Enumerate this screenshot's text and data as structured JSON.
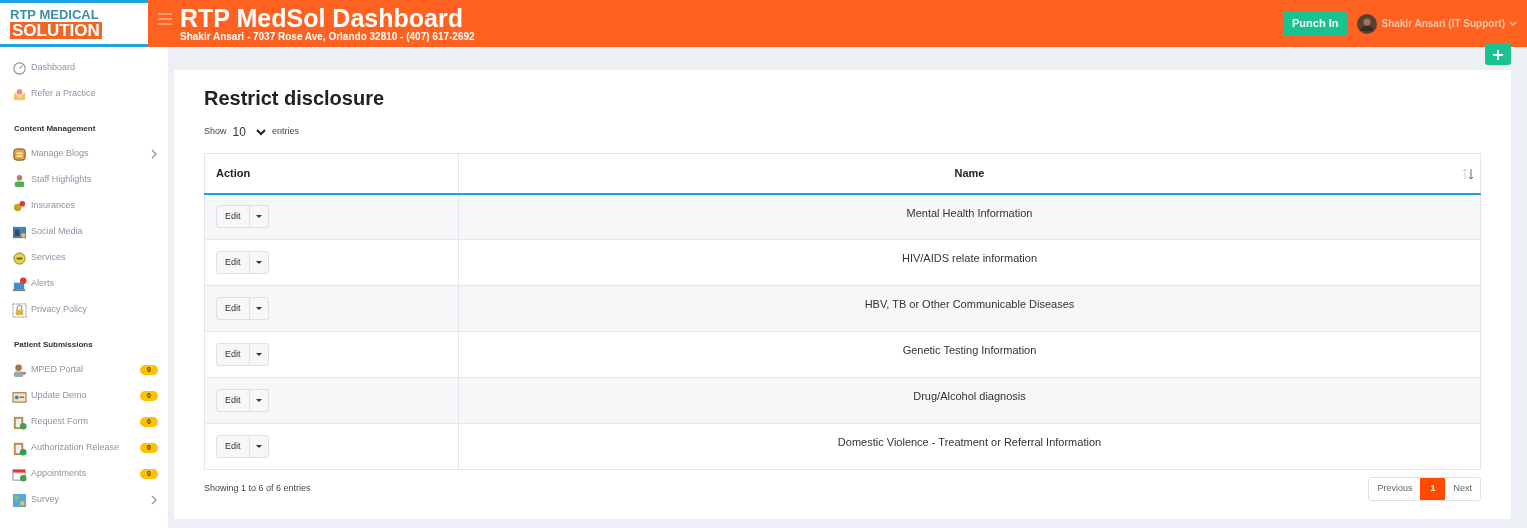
{
  "header": {
    "logo_top": "RTP MEDICAL",
    "logo_bottom": "SOLUTION",
    "title": "RTP MedSol Dashboard",
    "subtitle": "Shakir Ansari - 7037 Rose Ave, Orlando 32810 - (407) 617-2692",
    "punch_button": "Punch In",
    "user": "Shakir Ansari (IT Support)"
  },
  "sidebar": {
    "sections": [
      {
        "items": [
          {
            "label": "Dashboard",
            "has_submenu": false
          },
          {
            "label": "Refer a Practice",
            "has_submenu": false
          }
        ]
      },
      {
        "heading": "Content Management",
        "items": [
          {
            "label": "Manage Blogs",
            "has_submenu": true
          },
          {
            "label": "Staff Highlights",
            "has_submenu": false
          },
          {
            "label": "Insurances",
            "has_submenu": false
          },
          {
            "label": "Social Media",
            "has_submenu": false
          },
          {
            "label": "Services",
            "has_submenu": false
          },
          {
            "label": "Alerts",
            "has_submenu": false
          },
          {
            "label": "Privacy Policy",
            "has_submenu": false
          }
        ]
      },
      {
        "heading": "Patient Submissions",
        "items": [
          {
            "label": "MPED Portal",
            "badge": "0",
            "has_submenu": false
          },
          {
            "label": "Update Demo",
            "badge": "0",
            "has_submenu": false
          },
          {
            "label": "Request Form",
            "badge": "0",
            "has_submenu": false
          },
          {
            "label": "Authorization Release",
            "badge": "0",
            "has_submenu": false
          },
          {
            "label": "Appointments",
            "badge": "0",
            "has_submenu": false
          },
          {
            "label": "Survey",
            "has_submenu": true
          }
        ]
      }
    ]
  },
  "page": {
    "title": "Restrict disclosure",
    "show_label": "Show",
    "page_size": "10",
    "entries_label": "entries",
    "table": {
      "columns": [
        "Action",
        "Name"
      ],
      "rows": [
        {
          "action": "Edit",
          "name": "Mental Health Information"
        },
        {
          "action": "Edit",
          "name": "HIV/AIDS relate information"
        },
        {
          "action": "Edit",
          "name": "HBV, TB or Other Communicable Diseases"
        },
        {
          "action": "Edit",
          "name": "Genetic Testing Information"
        },
        {
          "action": "Edit",
          "name": "Drug/Alcohol diagnosis"
        },
        {
          "action": "Edit",
          "name": "Domestic Violence - Treatment or Referral Information"
        }
      ]
    },
    "info": "Showing 1 to 6 of 6 entries",
    "pagination": [
      {
        "label": "Previous",
        "selected": false
      },
      {
        "label": "1",
        "selected": true
      },
      {
        "label": "Next",
        "selected": false
      }
    ]
  }
}
